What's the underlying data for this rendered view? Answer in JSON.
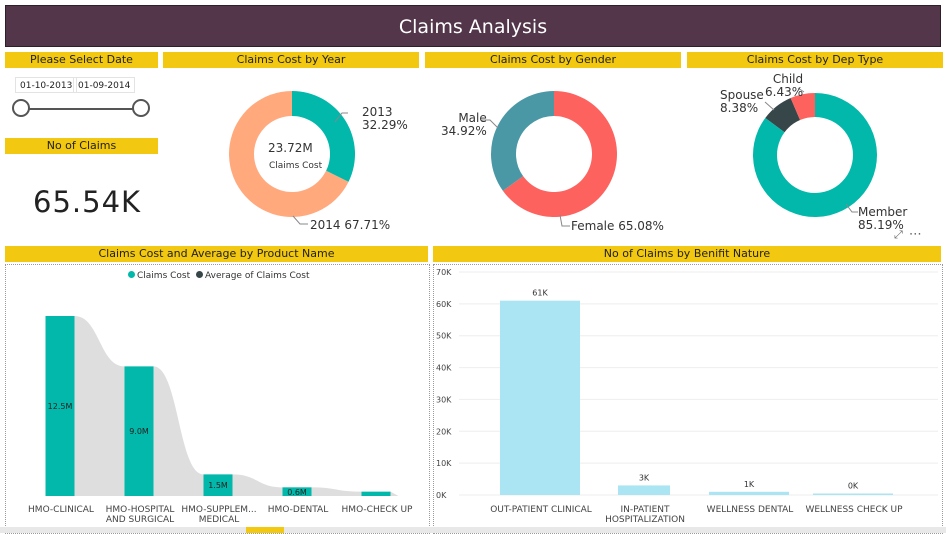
{
  "report": {
    "title": "Claims Analysis"
  },
  "date_slicer": {
    "header": "Please Select Date",
    "start": "01-10-2013",
    "end": "01-09-2014"
  },
  "kpi": {
    "header": "No of Claims",
    "value": "65.54K"
  },
  "colors": {
    "title_bar": "#533649",
    "header_yellow": "#f2c811",
    "teal": "#01b8aa",
    "salmon": "#fd625e",
    "peach": "#ffa97d",
    "dark": "#374649",
    "light_blue": "#abe4f3",
    "slate_blue": "#4a98a5",
    "grey_area": "#dedede"
  },
  "visual_icons": {
    "focus": "expand-icon",
    "more": "more-options-icon"
  },
  "year_chart": {
    "header": "Claims Cost by Year",
    "center_value": "23.72M",
    "center_label": "Claims Cost",
    "chart_data": {
      "type": "pie",
      "donut": true,
      "title": "Claims Cost by Year",
      "slices": [
        {
          "name": "2013",
          "pct": 32.29,
          "color": "#01b8aa",
          "label": "2013\n32.29%"
        },
        {
          "name": "2014",
          "pct": 67.71,
          "color": "#ffa97d",
          "label": "2014 67.71%"
        }
      ]
    }
  },
  "gender_chart": {
    "header": "Claims Cost by Gender",
    "chart_data": {
      "type": "pie",
      "donut": true,
      "title": "Claims Cost by Gender",
      "slices": [
        {
          "name": "Female",
          "pct": 65.08,
          "color": "#fd625e",
          "label": "Female 65.08%"
        },
        {
          "name": "Male",
          "pct": 34.92,
          "color": "#4a98a5",
          "label": "Male\n34.92%"
        }
      ]
    }
  },
  "dep_chart": {
    "header": "Claims Cost by Dep Type",
    "chart_data": {
      "type": "pie",
      "donut": true,
      "title": "Claims Cost by Dep Type",
      "slices": [
        {
          "name": "Member",
          "pct": 85.19,
          "color": "#01b8aa",
          "label": "Member\n85.19%"
        },
        {
          "name": "Spouse",
          "pct": 8.38,
          "color": "#374649",
          "label": "Spouse\n8.38%"
        },
        {
          "name": "Child",
          "pct": 6.43,
          "color": "#fd625e",
          "label": "Child\n6.43%"
        }
      ]
    }
  },
  "product_chart": {
    "header": "Claims Cost and Average by Product Name",
    "legend": [
      {
        "name": "Claims Cost",
        "color": "#01b8aa"
      },
      {
        "name": "Average of Claims Cost",
        "color": "#374649"
      }
    ],
    "chart_data": {
      "type": "bar",
      "title": "Claims Cost and Average by Product Name",
      "categories": [
        "HMO-CLINICAL",
        "HMO-HOSPITAL AND SURGICAL",
        "HMO-SUPPLEM... MEDICAL",
        "HMO-DENTAL",
        "HMO-CHECK UP"
      ],
      "series": [
        {
          "name": "Claims Cost",
          "values": [
            12.5,
            9.0,
            1.5,
            0.6,
            0.3
          ],
          "labels": [
            "12.5M",
            "9.0M",
            "1.5M",
            "0.6M",
            ""
          ]
        },
        {
          "name": "Average of Claims Cost",
          "kind": "area",
          "values": [
            12.5,
            9.0,
            1.5,
            0.6,
            0.3
          ]
        }
      ],
      "ylim": [
        0,
        14
      ]
    }
  },
  "benefit_chart": {
    "header": "No of Claims by Benifit Nature",
    "chart_data": {
      "type": "bar",
      "title": "No of Claims by Benifit Nature",
      "categories": [
        "OUT-PATIENT CLINICAL",
        "IN-PATIENT HOSPITALIZATION",
        "WELLNESS DENTAL",
        "WELLNESS CHECK UP"
      ],
      "values": [
        61,
        3,
        1,
        0.2
      ],
      "labels": [
        "61K",
        "3K",
        "1K",
        "0K"
      ],
      "yticks": [
        "0K",
        "10K",
        "20K",
        "30K",
        "40K",
        "50K",
        "60K",
        "70K"
      ],
      "ylim": [
        0,
        70
      ]
    }
  }
}
